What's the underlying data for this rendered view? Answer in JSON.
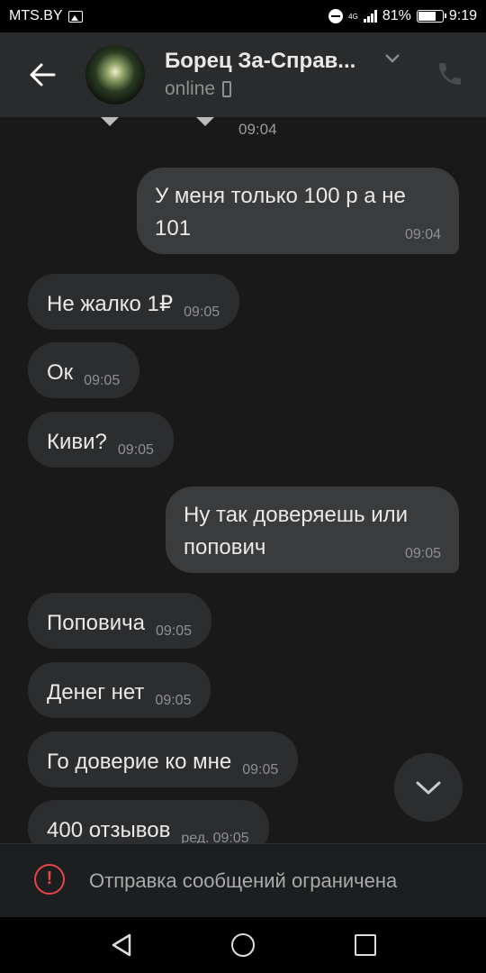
{
  "status_bar": {
    "carrier": "MTS.BY",
    "network": "4G",
    "battery": "81%",
    "battery_level": 0.81,
    "time": "9:19"
  },
  "header": {
    "name": "Борец За-Справ...",
    "status": "online"
  },
  "sticker_time": "09:04",
  "messages": [
    {
      "dir": "out",
      "text": "У меня только 100 р а не 101",
      "time": "09:04"
    },
    {
      "dir": "in",
      "text": "Не жалко 1₽",
      "time": "09:05"
    },
    {
      "dir": "in",
      "text": "Ок",
      "time": "09:05"
    },
    {
      "dir": "in",
      "text": "Киви?",
      "time": "09:05"
    },
    {
      "dir": "out",
      "text": "Ну так доверяешь или попович",
      "time": "09:05"
    },
    {
      "dir": "in",
      "text": "Поповича",
      "time": "09:05"
    },
    {
      "dir": "in",
      "text": "Денег нет",
      "time": "09:05"
    },
    {
      "dir": "in",
      "text": "Го доверие ко мне",
      "time": "09:05"
    },
    {
      "dir": "in",
      "text": "400 отзывов",
      "edited": "ред.",
      "time": "09:05"
    }
  ],
  "restriction_notice": "Отправка сообщений ограничена",
  "colors": {
    "background": "#19191a",
    "header": "#2a2b2c",
    "bubble_in": "#2c2d2f",
    "bubble_out": "#3a3b3d",
    "warning": "#e64646"
  }
}
